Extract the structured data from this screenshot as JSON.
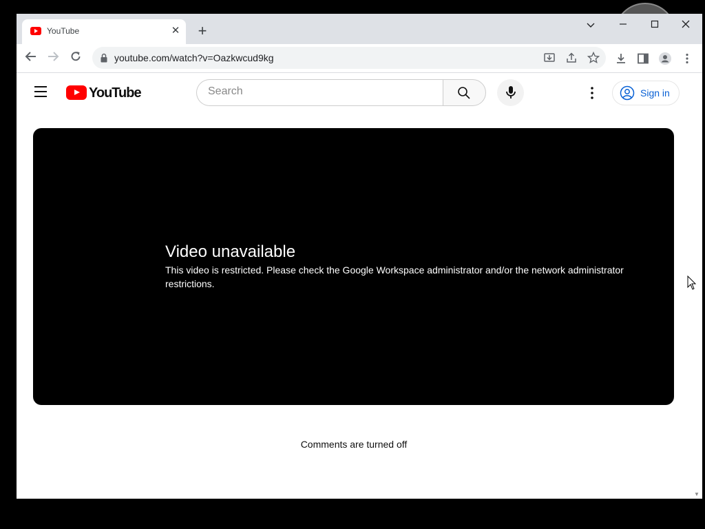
{
  "browser": {
    "tab_title": "YouTube",
    "tab_close_glyph": "✕",
    "new_tab_glyph": "+",
    "url": "youtube.com/watch?v=Oazkwcud9kg"
  },
  "youtube": {
    "logo_text": "YouTube",
    "search_placeholder": "Search",
    "signin_label": "Sign in"
  },
  "player": {
    "title": "Video unavailable",
    "message": "This video is restricted. Please check the Google Workspace administrator and/or the network administrator restrictions."
  },
  "comments_status": "Comments are turned off",
  "colors": {
    "youtube_red": "#ff0000",
    "link_blue": "#065fd4",
    "chrome_frame": "#dee1e6"
  },
  "icons": [
    "youtube-favicon",
    "close-icon",
    "plus-icon",
    "chevron-down-icon",
    "minimize-icon",
    "maximize-icon",
    "window-close-icon",
    "back-icon",
    "forward-icon",
    "reload-icon",
    "lock-icon",
    "install-icon",
    "share-icon",
    "star-icon",
    "download-icon",
    "side-panel-icon",
    "profile-icon",
    "kebab-icon",
    "hamburger-icon",
    "search-icon",
    "mic-icon",
    "user-circle-icon",
    "mouse-cursor-icon"
  ]
}
